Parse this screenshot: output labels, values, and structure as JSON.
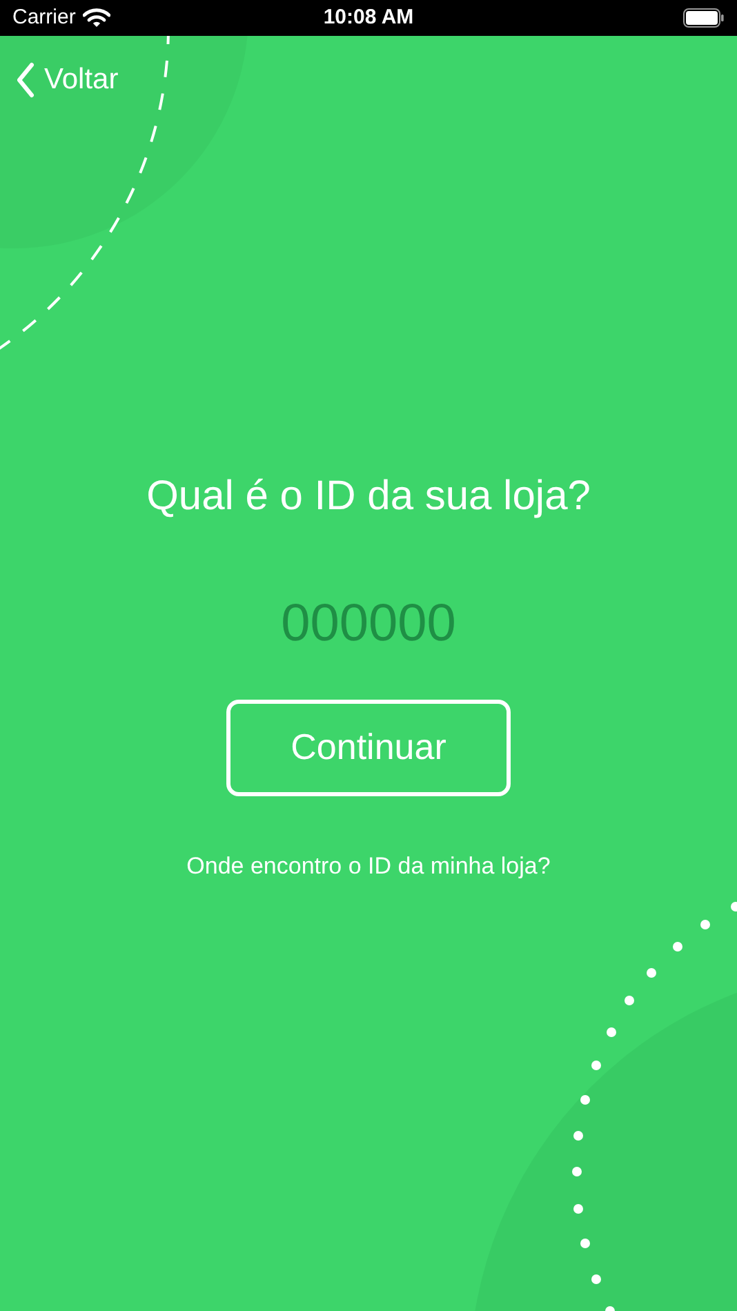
{
  "status_bar": {
    "carrier": "Carrier",
    "time": "10:08 AM"
  },
  "nav": {
    "back_label": "Voltar"
  },
  "title": "Qual é o ID da sua loja?",
  "store_id_field": {
    "placeholder": "000000"
  },
  "continue_button": {
    "label": "Continuar"
  },
  "help_link": "Onde encontro o ID da minha loja?"
}
